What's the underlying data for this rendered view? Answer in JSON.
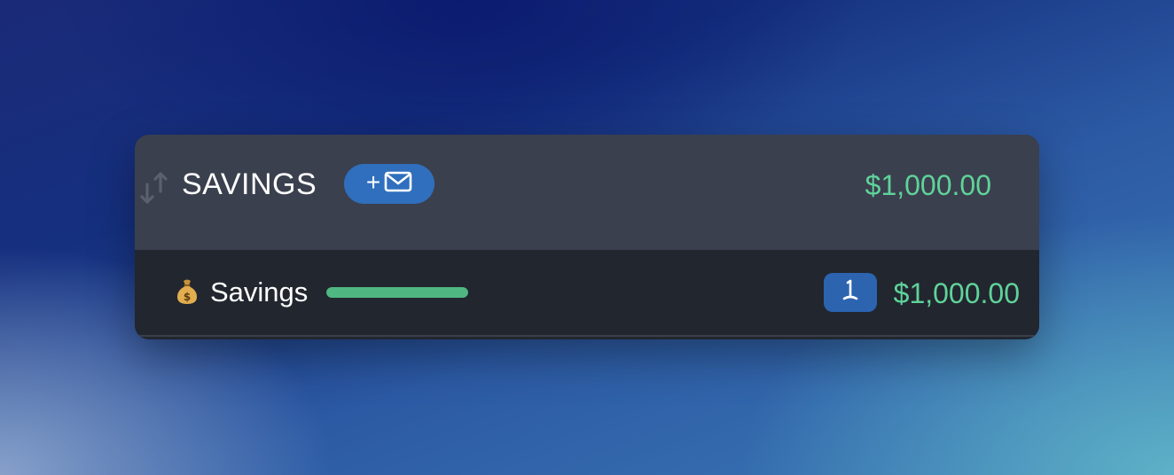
{
  "group": {
    "title": "SAVINGS",
    "total": "$1,000.00",
    "add_envelope_plus": "+",
    "add_envelope_icon": "envelope-icon",
    "sort_icon": "sort-arrows-icon"
  },
  "envelopes": [
    {
      "emoji": "money-bag-icon",
      "name": "Savings",
      "progress_percent": 100,
      "transfer_icon": "transfer-down-icon",
      "amount": "$1,000.00"
    }
  ],
  "colors": {
    "header_bg": "#3b404e",
    "row_bg": "#22262f",
    "accent_blue": "#2f6fbd",
    "positive_green": "#5fd39a",
    "progress_green": "#4fb882"
  }
}
